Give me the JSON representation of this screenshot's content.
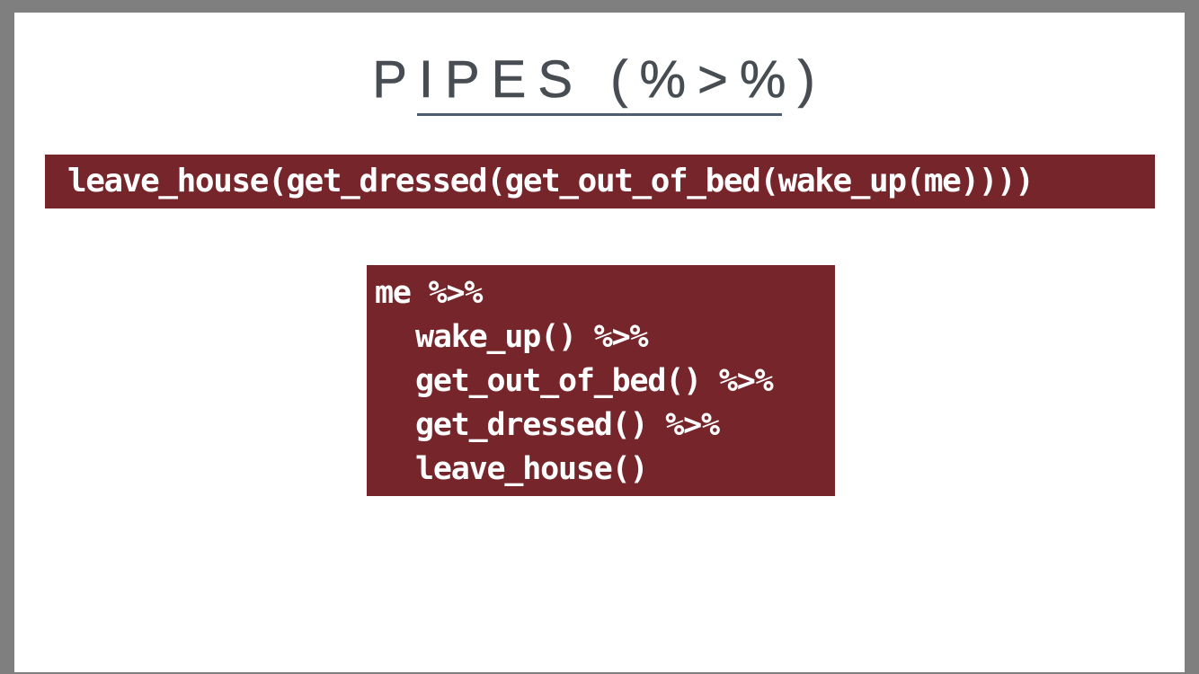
{
  "slide": {
    "title": "PIPES (%>%)",
    "nested_code": "leave_house(get_dressed(get_out_of_bed(wake_up(me))))",
    "pipe_code": [
      "me %>%",
      "wake_up() %>%",
      "get_out_of_bed() %>%",
      "get_dressed() %>%",
      "leave_house()"
    ]
  },
  "colors": {
    "page_border": "#7f7f7f",
    "slide_background": "#ffffff",
    "title_text": "#474d52",
    "title_underline": "#4d5b6e",
    "code_background": "#76262b",
    "code_text": "#ffffff"
  }
}
